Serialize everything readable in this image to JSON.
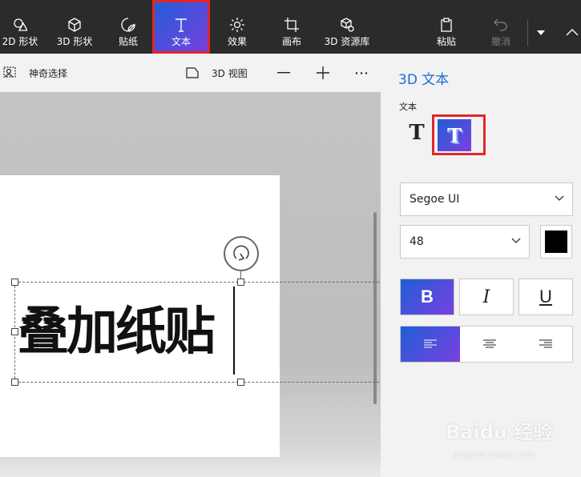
{
  "toolbar": {
    "tools": [
      {
        "label": "2D 形状",
        "icon": "shapes-2d-icon"
      },
      {
        "label": "3D 形状",
        "icon": "cube-icon"
      },
      {
        "label": "贴纸",
        "icon": "sticker-icon"
      },
      {
        "label": "文本",
        "icon": "text-icon",
        "selected": true
      },
      {
        "label": "效果",
        "icon": "sun-icon"
      },
      {
        "label": "画布",
        "icon": "canvas-crop-icon"
      },
      {
        "label": "3D 资源库",
        "icon": "3d-library-icon"
      }
    ],
    "paste_label": "粘贴",
    "undo_label": "撤消",
    "undo_disabled": true
  },
  "subbar": {
    "magic_select_label": "神奇选择",
    "view3d_label": "3D 视图"
  },
  "canvas": {
    "text": "叠加纸贴"
  },
  "panel": {
    "title": "3D 文本",
    "text_section_label": "文本",
    "text_mode_selected": "3d",
    "font_family_value": "Segoe UI",
    "font_size_value": "48",
    "text_color": "#000000",
    "bold_label": "B",
    "italic_label": "I",
    "underline_label": "U",
    "bold_active": true,
    "alignment_selected": "left"
  },
  "watermark": {
    "brand": "Baidu 经验",
    "url": "jingyan.baidu.com"
  },
  "colors": {
    "toolbar_bg": "#2b2b2b",
    "accent_gradient_start": "#1f5fd6",
    "accent_gradient_end": "#7a3fe0",
    "highlight_box": "#e0262b",
    "panel_title": "#1c6cd3"
  }
}
